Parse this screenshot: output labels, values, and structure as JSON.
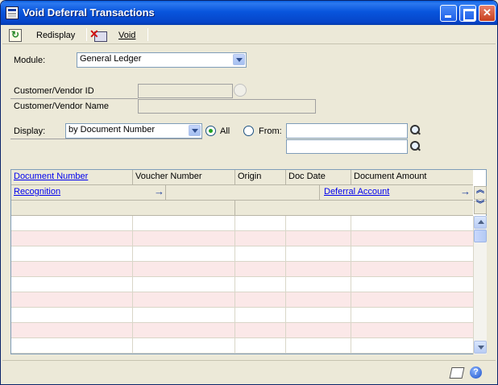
{
  "window": {
    "title": "Void Deferral Transactions"
  },
  "toolbar": {
    "redisplay_label": "Redisplay",
    "void_label": "Void"
  },
  "form": {
    "module_label": "Module:",
    "module_value": "General Ledger",
    "customer_vendor_id_label": "Customer/Vendor ID",
    "customer_vendor_name_label": "Customer/Vendor Name",
    "display_label": "Display:",
    "display_value": "by Document Number",
    "all_label": "All",
    "from_label": "From:",
    "display_mode": "All"
  },
  "grid": {
    "headers_row1": [
      "Document Number",
      "Voucher Number",
      "Origin",
      "Doc Date",
      "Document Amount"
    ],
    "headers_row2": [
      "Recognition",
      "Deferral Account"
    ],
    "row_count": 9
  },
  "colors": {
    "title_bar": "#0855dd",
    "row_alt": "#fbe8e8",
    "link": "#0000ee"
  },
  "icons": [
    "redisplay-icon",
    "void-icon",
    "lookup-icon",
    "note-icon",
    "help-icon"
  ]
}
